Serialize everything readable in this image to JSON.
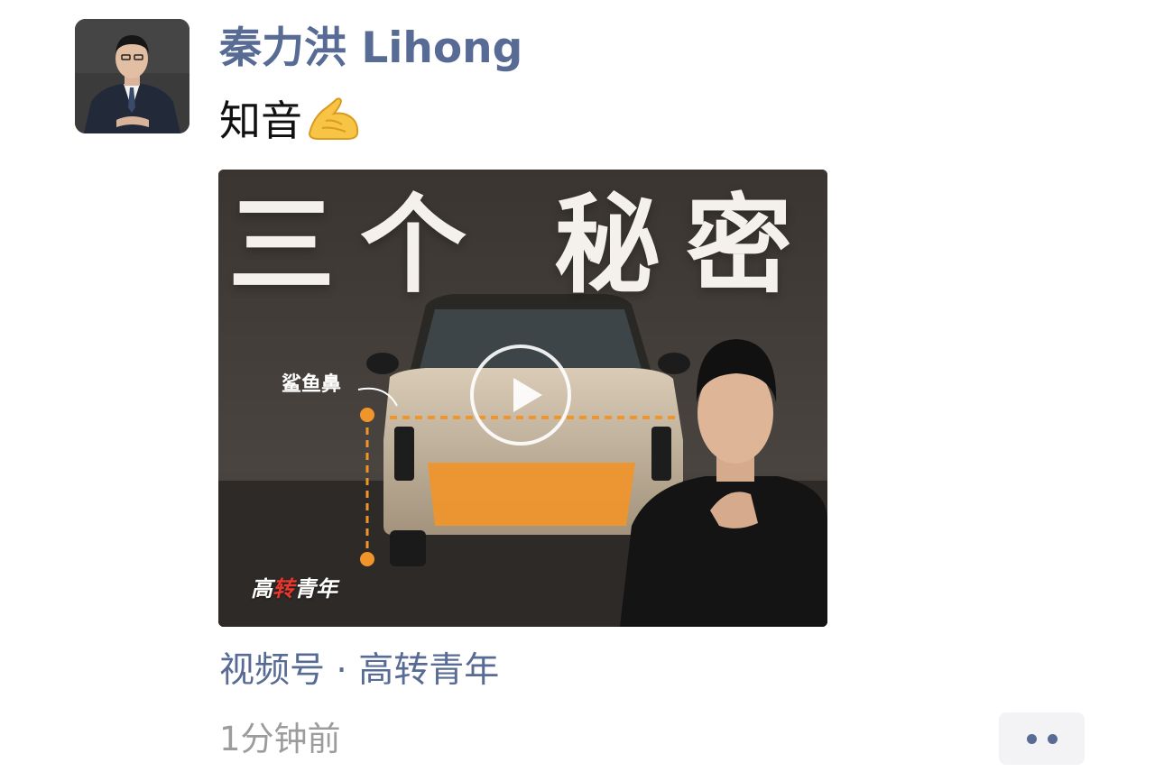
{
  "post": {
    "author": "秦力洪 Lihong",
    "text": "知音",
    "emoji_icon": "pinching-hand-emoji",
    "channel_link": "视频号 · 高转青年",
    "timestamp": "1分钟前"
  },
  "video": {
    "cover_headline": "三个 秘密",
    "cover_label": "鲨鱼鼻",
    "cover_watermark_part1": "高",
    "cover_watermark_part2": "转",
    "cover_watermark_part3": "青年",
    "play_icon": "play-icon"
  },
  "colors": {
    "link": "#576b95",
    "timestamp": "#9c9c9c",
    "accent_orange": "#f0952a"
  },
  "icons": {
    "more": "more-dots-icon"
  }
}
